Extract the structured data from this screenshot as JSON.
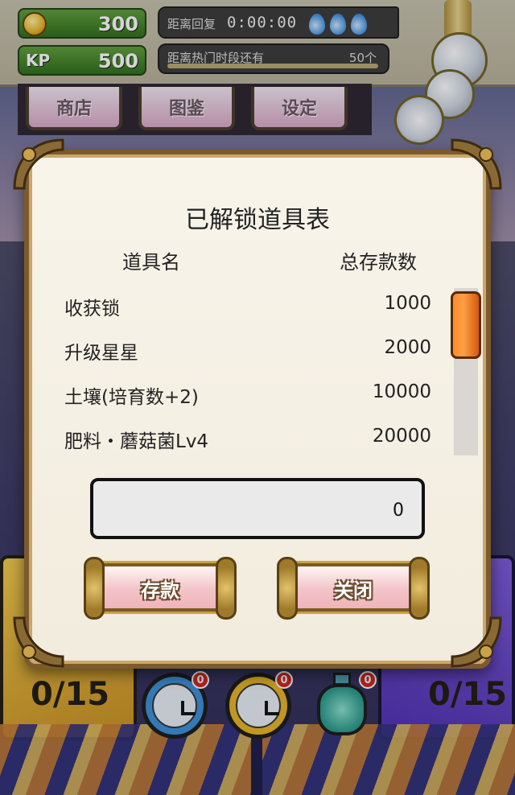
{
  "hud": {
    "coins": "300",
    "kp_label": "KP",
    "kp_value": "500",
    "recovery_label": "距离回复",
    "recovery_time": "0:00:00",
    "hot_label": "距离热门时段还有",
    "hot_count": "50个",
    "hot_progress": 0.0,
    "water_drops": 3
  },
  "tabs": [
    {
      "label": "商店"
    },
    {
      "label": "图鉴"
    },
    {
      "label": "设定"
    }
  ],
  "dialog": {
    "title": "已解锁道具表",
    "col_name": "道具名",
    "col_amount": "总存款数",
    "items": [
      {
        "name": "收获锁",
        "amount": "1000"
      },
      {
        "name": "升级星星",
        "amount": "2000"
      },
      {
        "name": "土壤(培育数+2)",
        "amount": "10000"
      },
      {
        "name": "肥料・蘑菇菌Lv4",
        "amount": "20000"
      }
    ],
    "input_value": "0",
    "deposit_label": "存款",
    "close_label": "关闭",
    "scroll_position": 0.0
  },
  "scene": {
    "left_box_count": "0/15",
    "right_box_count": "0/15",
    "bottom_items": [
      {
        "icon": "blue-clock-icon",
        "badge": "0"
      },
      {
        "icon": "yellow-clock-icon",
        "badge": "0"
      },
      {
        "icon": "bottle-icon",
        "badge": "0"
      }
    ]
  },
  "colors": {
    "accent_orange": "#ff8a2a",
    "resource_green": "#2f6e1a",
    "frame_gold": "#7d5a2c"
  }
}
